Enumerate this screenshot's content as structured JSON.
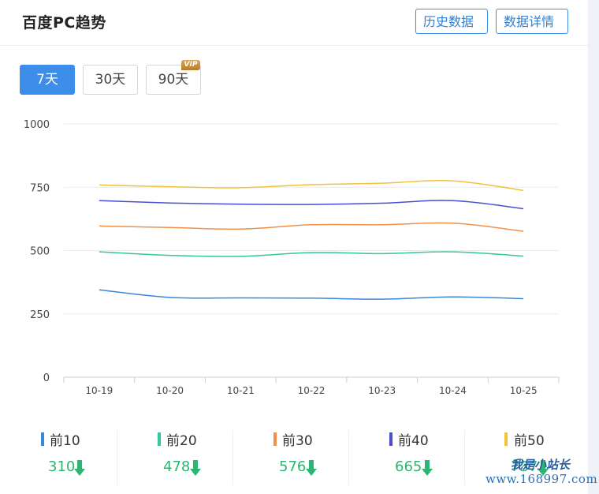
{
  "header": {
    "title": "百度PC趋势",
    "history_button": "历史数据",
    "detail_button": "数据详情"
  },
  "ranges": [
    {
      "label": "7天",
      "active": true
    },
    {
      "label": "30天",
      "active": false
    },
    {
      "label": "90天",
      "active": false,
      "badge": "VIP"
    }
  ],
  "chart_data": {
    "type": "line",
    "categories": [
      "10-19",
      "10-20",
      "10-21",
      "10-22",
      "10-23",
      "10-24",
      "10-25"
    ],
    "y_ticks": [
      "0",
      "250",
      "500",
      "750",
      "1000"
    ],
    "ylim": [
      0,
      1000
    ],
    "grid": true,
    "series": [
      {
        "name": "前10",
        "color": "#3c86d8",
        "values": [
          345,
          315,
          313,
          312,
          308,
          317,
          310
        ]
      },
      {
        "name": "前20",
        "color": "#36c6a0",
        "values": [
          495,
          481,
          477,
          492,
          488,
          495,
          478
        ]
      },
      {
        "name": "前30",
        "color": "#f0904a",
        "values": [
          597,
          591,
          585,
          602,
          602,
          608,
          576
        ]
      },
      {
        "name": "前40",
        "color": "#4b4fcf",
        "values": [
          697,
          688,
          683,
          682,
          687,
          697,
          665
        ]
      },
      {
        "name": "前50",
        "color": "#f2c23c",
        "values": [
          759,
          752,
          748,
          760,
          766,
          775,
          737
        ]
      }
    ]
  },
  "legend": [
    {
      "name": "前10",
      "value": "310",
      "trend": "down",
      "color": "#3c86d8"
    },
    {
      "name": "前20",
      "value": "478",
      "trend": "down",
      "color": "#36c6a0"
    },
    {
      "name": "前30",
      "value": "576",
      "trend": "down",
      "color": "#f0904a"
    },
    {
      "name": "前40",
      "value": "665",
      "trend": "down",
      "color": "#4b4fcf"
    },
    {
      "name": "前50",
      "value": "737",
      "trend": "down",
      "color": "#f2c23c"
    }
  ],
  "watermark": {
    "line1": "我是小站长",
    "line2": "www.168997.com"
  }
}
